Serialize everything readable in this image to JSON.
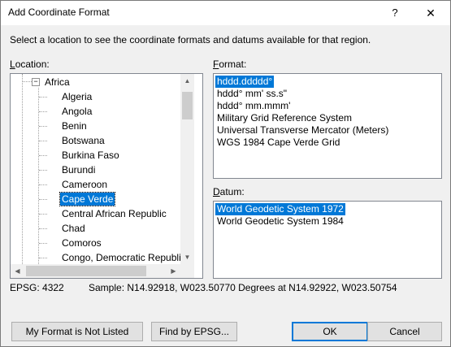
{
  "window": {
    "title": "Add Coordinate Format",
    "help_label": "?",
    "close_label": "✕"
  },
  "instruction": "Select a location to see the coordinate formats and datums available for that region.",
  "location": {
    "label_u": "L",
    "label_rest": "ocation:",
    "root": "Africa",
    "expander": "−",
    "items": [
      "Algeria",
      "Angola",
      "Benin",
      "Botswana",
      "Burkina Faso",
      "Burundi",
      "Cameroon",
      "Cape Verde",
      "Central African Republic",
      "Chad",
      "Comoros",
      "Congo, Democratic Republi"
    ],
    "selected_index": 7
  },
  "format": {
    "label_u": "F",
    "label_rest": "ormat:",
    "items": [
      "hddd.ddddd°",
      "hddd° mm' ss.s\"",
      "hddd° mm.mmm'",
      "Military Grid Reference System",
      "Universal Transverse Mercator (Meters)",
      "WGS 1984 Cape Verde Grid"
    ],
    "selected_index": 0
  },
  "datum": {
    "label_u": "D",
    "label_rest": "atum:",
    "items": [
      "World Geodetic System 1972",
      "World Geodetic System 1984"
    ],
    "selected_index": 0
  },
  "status": {
    "epsg": "EPSG: 4322",
    "sample": "Sample: N14.92918, W023.50770 Degrees at N14.92922, W023.50754"
  },
  "buttons": {
    "not_listed": "My Format is Not Listed",
    "find_epsg": "Find by EPSG...",
    "ok": "OK",
    "cancel": "Cancel"
  },
  "icons": {
    "scroll_up": "▲",
    "scroll_down": "▼",
    "scroll_left": "◀",
    "scroll_right": "▶"
  }
}
